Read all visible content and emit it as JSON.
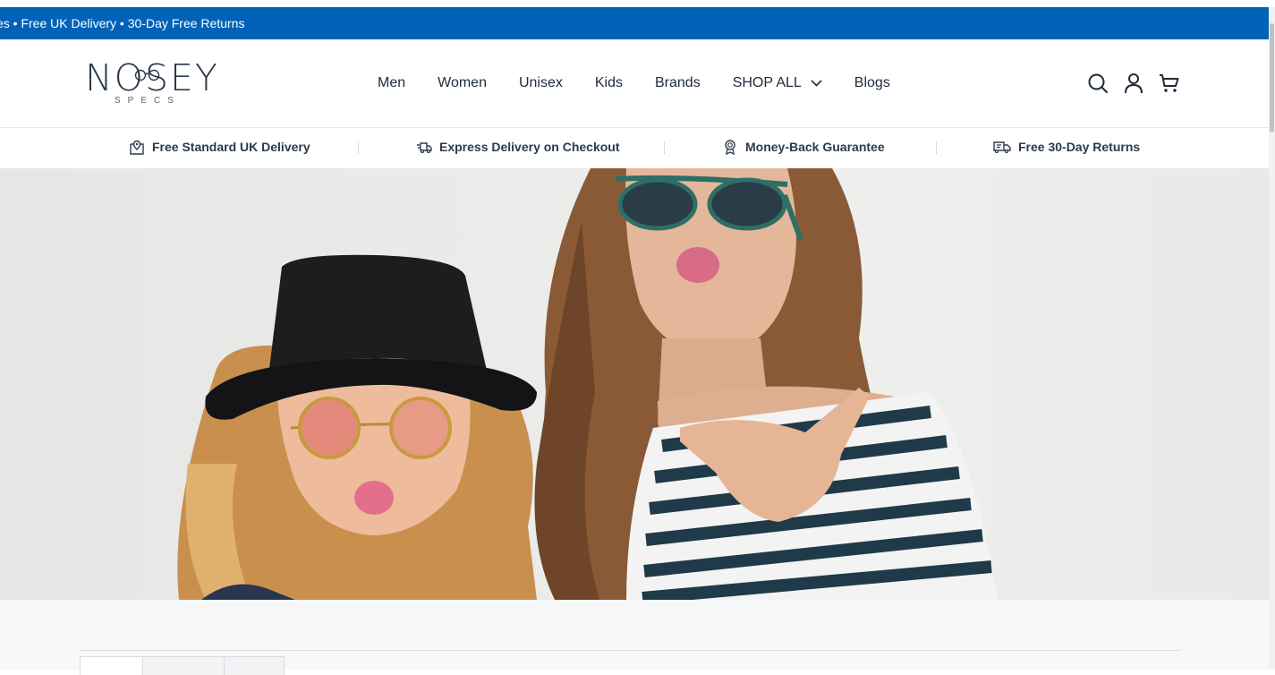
{
  "announcement": {
    "text": "es • Free UK Delivery • 30-Day Free Returns"
  },
  "brand": {
    "name": "NOSEY",
    "tagline": "SPECS",
    "color": "#2b3a4d",
    "accent": "#0062b8"
  },
  "nav": {
    "items": [
      {
        "label": "Men"
      },
      {
        "label": "Women"
      },
      {
        "label": "Unisex"
      },
      {
        "label": "Kids"
      },
      {
        "label": "Brands"
      },
      {
        "label": "SHOP ALL",
        "icon": "chevron-down-icon"
      },
      {
        "label": "Blogs"
      }
    ]
  },
  "header_icons": [
    "search-icon",
    "account-icon",
    "cart-icon"
  ],
  "benefits": [
    {
      "label": "Free Standard UK Delivery",
      "icon": "location-box-icon"
    },
    {
      "label": "Express Delivery on Checkout",
      "icon": "fast-truck-icon"
    },
    {
      "label": "Money-Back Guarantee",
      "icon": "award-badge-icon"
    },
    {
      "label": "Free 30-Day Returns",
      "icon": "return-truck-icon"
    }
  ]
}
